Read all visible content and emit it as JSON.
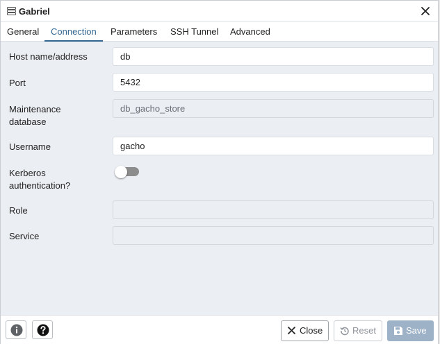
{
  "window": {
    "title": "Gabriel",
    "icon": "server-icon",
    "close_icon": "close-icon"
  },
  "tabs": [
    {
      "label": "General",
      "active": false
    },
    {
      "label": "Connection",
      "active": true
    },
    {
      "label": "Parameters",
      "active": false
    },
    {
      "label": "SSH Tunnel",
      "active": false
    },
    {
      "label": "Advanced",
      "active": false
    }
  ],
  "form": {
    "host": {
      "label": "Host name/address",
      "value": "db"
    },
    "port": {
      "label": "Port",
      "value": "5432"
    },
    "maintenance_db": {
      "label_line1": "Maintenance",
      "label_line2": "database",
      "value": "db_gacho_store",
      "disabled": true
    },
    "username": {
      "label": "Username",
      "value": "gacho"
    },
    "kerberos": {
      "label_line1": "Kerberos",
      "label_line2": "authentication?",
      "enabled": false
    },
    "role": {
      "label": "Role",
      "value": "",
      "disabled": true
    },
    "service": {
      "label": "Service",
      "value": "",
      "disabled": true
    }
  },
  "footer": {
    "info_icon": "info-icon",
    "help_icon": "help-icon",
    "close_label": "Close",
    "reset_label": "Reset",
    "save_label": "Save"
  },
  "colors": {
    "accent": "#326690",
    "save_button_disabled": "#9db2c7",
    "toggle_off": "#8c8c8c"
  }
}
